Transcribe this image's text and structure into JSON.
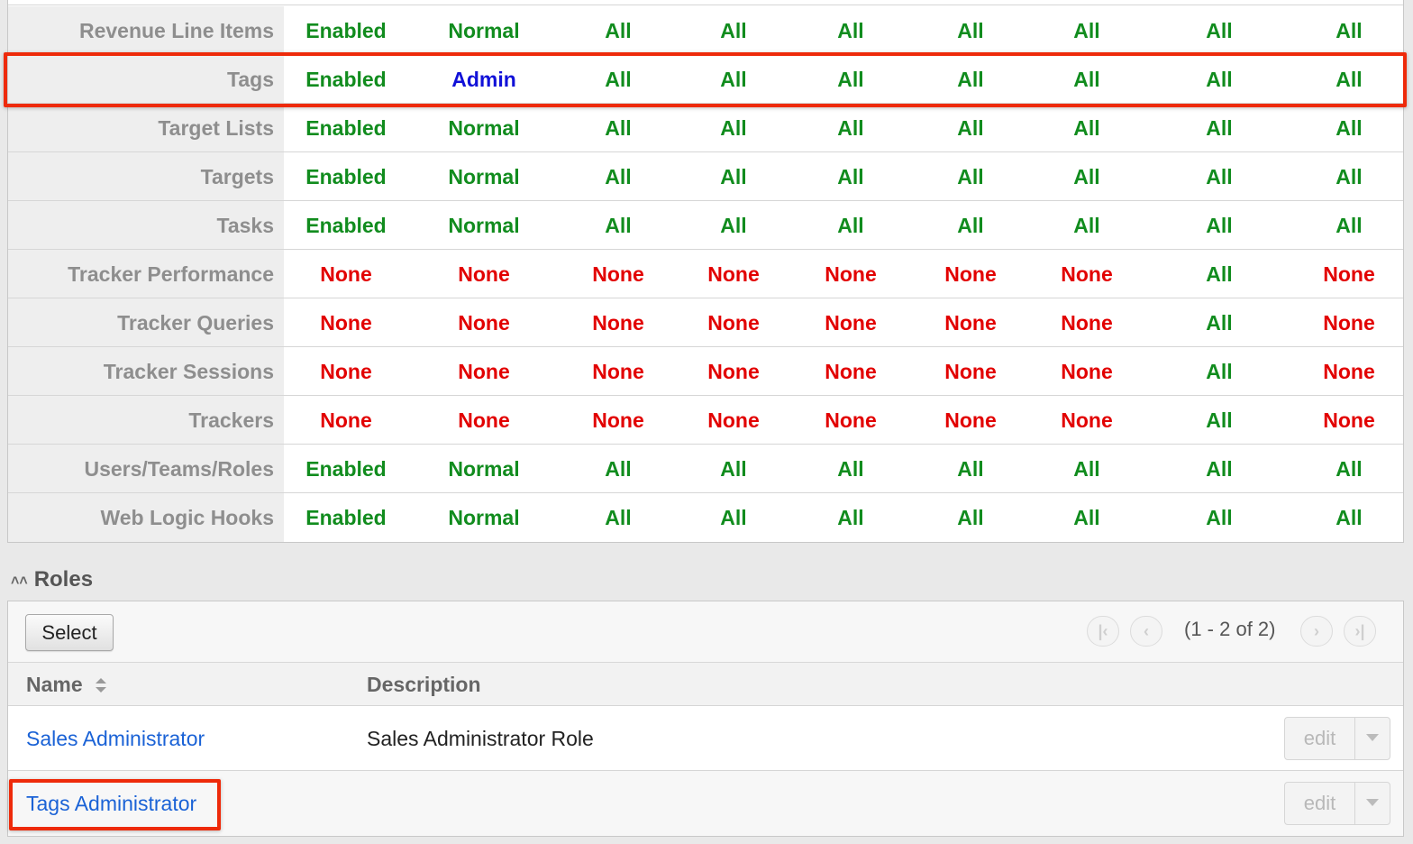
{
  "permissions": {
    "rows": [
      {
        "module": "Revenue Line Items",
        "values": [
          "Enabled",
          "Normal",
          "All",
          "All",
          "All",
          "All",
          "All",
          "All",
          "All"
        ]
      },
      {
        "module": "Tags",
        "values": [
          "Enabled",
          "Admin",
          "All",
          "All",
          "All",
          "All",
          "All",
          "All",
          "All"
        ]
      },
      {
        "module": "Target Lists",
        "values": [
          "Enabled",
          "Normal",
          "All",
          "All",
          "All",
          "All",
          "All",
          "All",
          "All"
        ]
      },
      {
        "module": "Targets",
        "values": [
          "Enabled",
          "Normal",
          "All",
          "All",
          "All",
          "All",
          "All",
          "All",
          "All"
        ]
      },
      {
        "module": "Tasks",
        "values": [
          "Enabled",
          "Normal",
          "All",
          "All",
          "All",
          "All",
          "All",
          "All",
          "All"
        ]
      },
      {
        "module": "Tracker Performance",
        "values": [
          "None",
          "None",
          "None",
          "None",
          "None",
          "None",
          "None",
          "All",
          "None"
        ]
      },
      {
        "module": "Tracker Queries",
        "values": [
          "None",
          "None",
          "None",
          "None",
          "None",
          "None",
          "None",
          "All",
          "None"
        ]
      },
      {
        "module": "Tracker Sessions",
        "values": [
          "None",
          "None",
          "None",
          "None",
          "None",
          "None",
          "None",
          "All",
          "None"
        ]
      },
      {
        "module": "Trackers",
        "values": [
          "None",
          "None",
          "None",
          "None",
          "None",
          "None",
          "None",
          "All",
          "None"
        ]
      },
      {
        "module": "Users/Teams/Roles",
        "values": [
          "Enabled",
          "Normal",
          "All",
          "All",
          "All",
          "All",
          "All",
          "All",
          "All"
        ]
      },
      {
        "module": "Web Logic Hooks",
        "values": [
          "Enabled",
          "Normal",
          "All",
          "All",
          "All",
          "All",
          "All",
          "All",
          "All"
        ]
      }
    ],
    "colors": {
      "Enabled": "#118c1e",
      "Normal": "#118c1e",
      "All": "#118c1e",
      "None": "#e20000",
      "Admin": "#1111d8"
    }
  },
  "roles": {
    "title": "Roles",
    "select_label": "Select",
    "pager_text": "(1 - 2 of 2)",
    "columns": {
      "name": "Name",
      "description": "Description"
    },
    "items": [
      {
        "name": "Sales Administrator",
        "description": "Sales Administrator Role",
        "edit_label": "edit"
      },
      {
        "name": "Tags Administrator",
        "description": "",
        "edit_label": "edit"
      }
    ]
  }
}
